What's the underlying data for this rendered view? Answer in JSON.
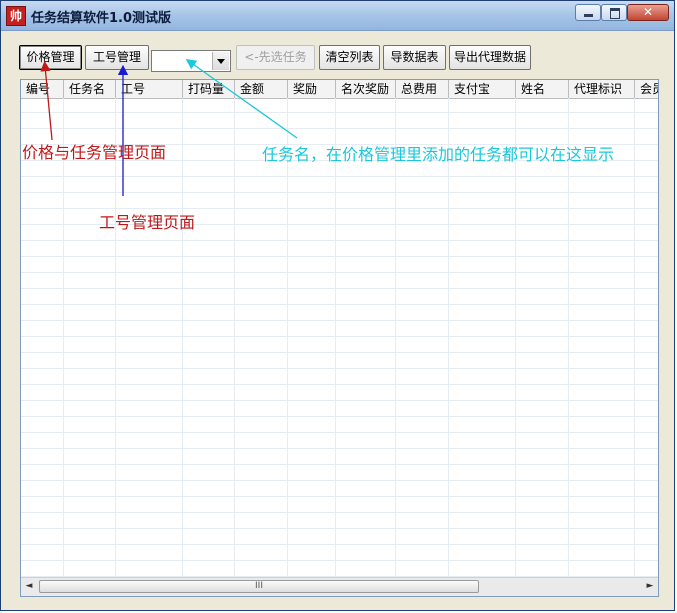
{
  "window": {
    "title": "任务结算软件1.0测试版",
    "app_icon_glyph": "帅",
    "min_icon": "minimize-icon",
    "max_icon": "maximize-icon",
    "close_icon": "close-icon",
    "close_glyph": "✕"
  },
  "toolbar": {
    "price_label": "价格管理",
    "staff_label": "工号管理",
    "task_select_value": "",
    "select_task_label": "<-先选任务",
    "clear_label": "清空列表",
    "import_label": "导数据表",
    "export_label": "导出代理数据"
  },
  "table": {
    "columns": [
      "编号",
      "任务名",
      "工号",
      "打码量",
      "金额",
      "奖励",
      "名次奖励",
      "总费用",
      "支付宝",
      "姓名",
      "代理标识",
      "会员"
    ],
    "rows": []
  },
  "scrollbar": {
    "left_arrow": "◄",
    "right_arrow": "►",
    "grip": "III"
  },
  "annotations": {
    "price_page": "价格与任务管理页面",
    "staff_page": "工号管理页面",
    "task_name_note": "任务名，在价格管理里添加的任务都可以在这显示"
  },
  "colors": {
    "annotation_red": "#c01818",
    "annotation_blue": "#1a1ad0",
    "annotation_cyan": "#1ac8dc"
  }
}
